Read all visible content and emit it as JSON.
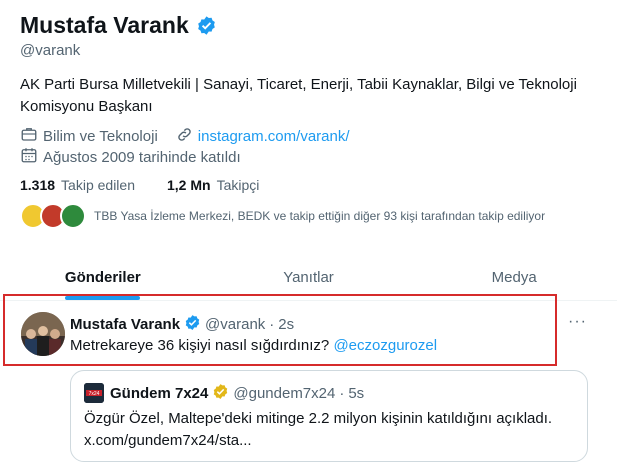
{
  "profile": {
    "name": "Mustafa Varank",
    "handle": "@varank",
    "bio": "AK Parti Bursa Milletvekili | Sanayi, Ticaret, Enerji, Tabii Kaynaklar, Bilgi ve Teknoloji Komisyonu Başkanı",
    "category": "Bilim ve Teknoloji",
    "link": "instagram.com/varank/",
    "joined": "Ağustos 2009 tarihinde katıldı",
    "following_count": "1.318",
    "following_label": "Takip edilen",
    "followers_count": "1,2 Mn",
    "followers_label": "Takipçi",
    "followed_by": "TBB Yasa İzleme Merkezi, BEDK ve takip ettiğin diğer 93 kişi tarafından takip ediliyor"
  },
  "tabs": [
    {
      "label": "Gönderiler",
      "active": true
    },
    {
      "label": "Yanıtlar",
      "active": false
    },
    {
      "label": "Medya",
      "active": false
    }
  ],
  "tweet": {
    "name": "Mustafa Varank",
    "handle": "@varank",
    "sep": "·",
    "time": "2s",
    "text": "Metrekareye 36 kişiyi nasıl sığdırdınız?",
    "mention": "@eczozgurozel",
    "more": "···"
  },
  "quote": {
    "name": "Gündem 7x24",
    "handle": "@gundem7x24",
    "sep": "·",
    "time": "5s",
    "text_line1": "Özgür Özel, Maltepe'deki mitinge 2.2 milyon kişinin katıldığını açıkladı.",
    "text_line2": "x.com/gundem7x24/sta...",
    "logo_text": "7x24"
  },
  "colors": {
    "accent": "#1d9bf0",
    "verified_blue": "#1d9bf0",
    "verified_gold": "#e2b719",
    "highlight_red": "#d62b2b",
    "muted": "#536471"
  },
  "icons": [
    "verified-badge-icon",
    "briefcase-icon",
    "link-icon",
    "calendar-icon",
    "more-icon",
    "verified-gold-icon"
  ]
}
